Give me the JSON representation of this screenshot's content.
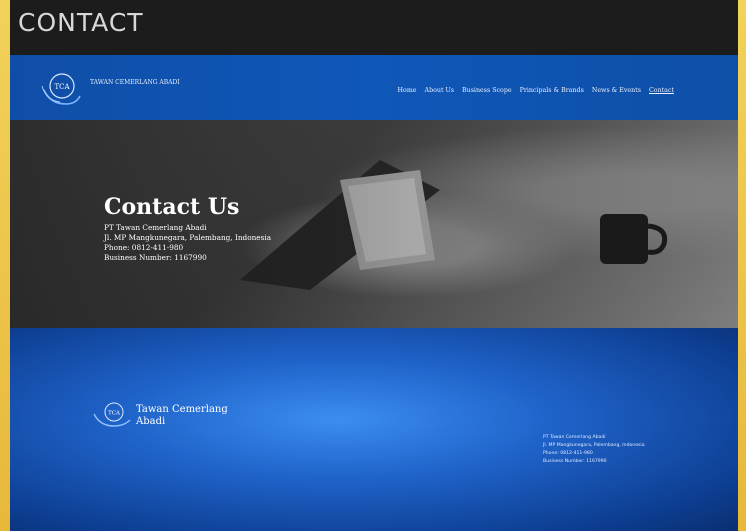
{
  "page_heading": "CONTACT",
  "nav": {
    "logo_text": "TAWAN CEMERLANG ABADI",
    "logo_abbrev": "TCA",
    "links": [
      "Home",
      "About Us",
      "Business Scope",
      "Principals & Brands",
      "News & Events",
      "Contact"
    ],
    "active": "Contact"
  },
  "hero": {
    "title": "Contact Us",
    "lines": [
      "PT Tawan Cemerlang Abadi",
      "Jl. MP Mangkunegara, Palembang, Indonesia",
      "Phone: 0812-411-980",
      "Business Number: 1167990"
    ]
  },
  "footer": {
    "brand_line1": "Tawan Cemerlang",
    "brand_line2": "Abadi",
    "logo_abbrev": "TCA",
    "info_lines": [
      "PT Tawan Cemerlang Abadi",
      "Jl. MP Mangkunegara, Palembang, Indonesia",
      "Phone: 0812-411-980",
      "Business Number: 1167990"
    ]
  },
  "colors": {
    "nav_bg": "#0f57b8",
    "footer_center": "#3c8df0",
    "footer_edge": "#0a2f70",
    "frame_bg": "#1c1c1c"
  }
}
